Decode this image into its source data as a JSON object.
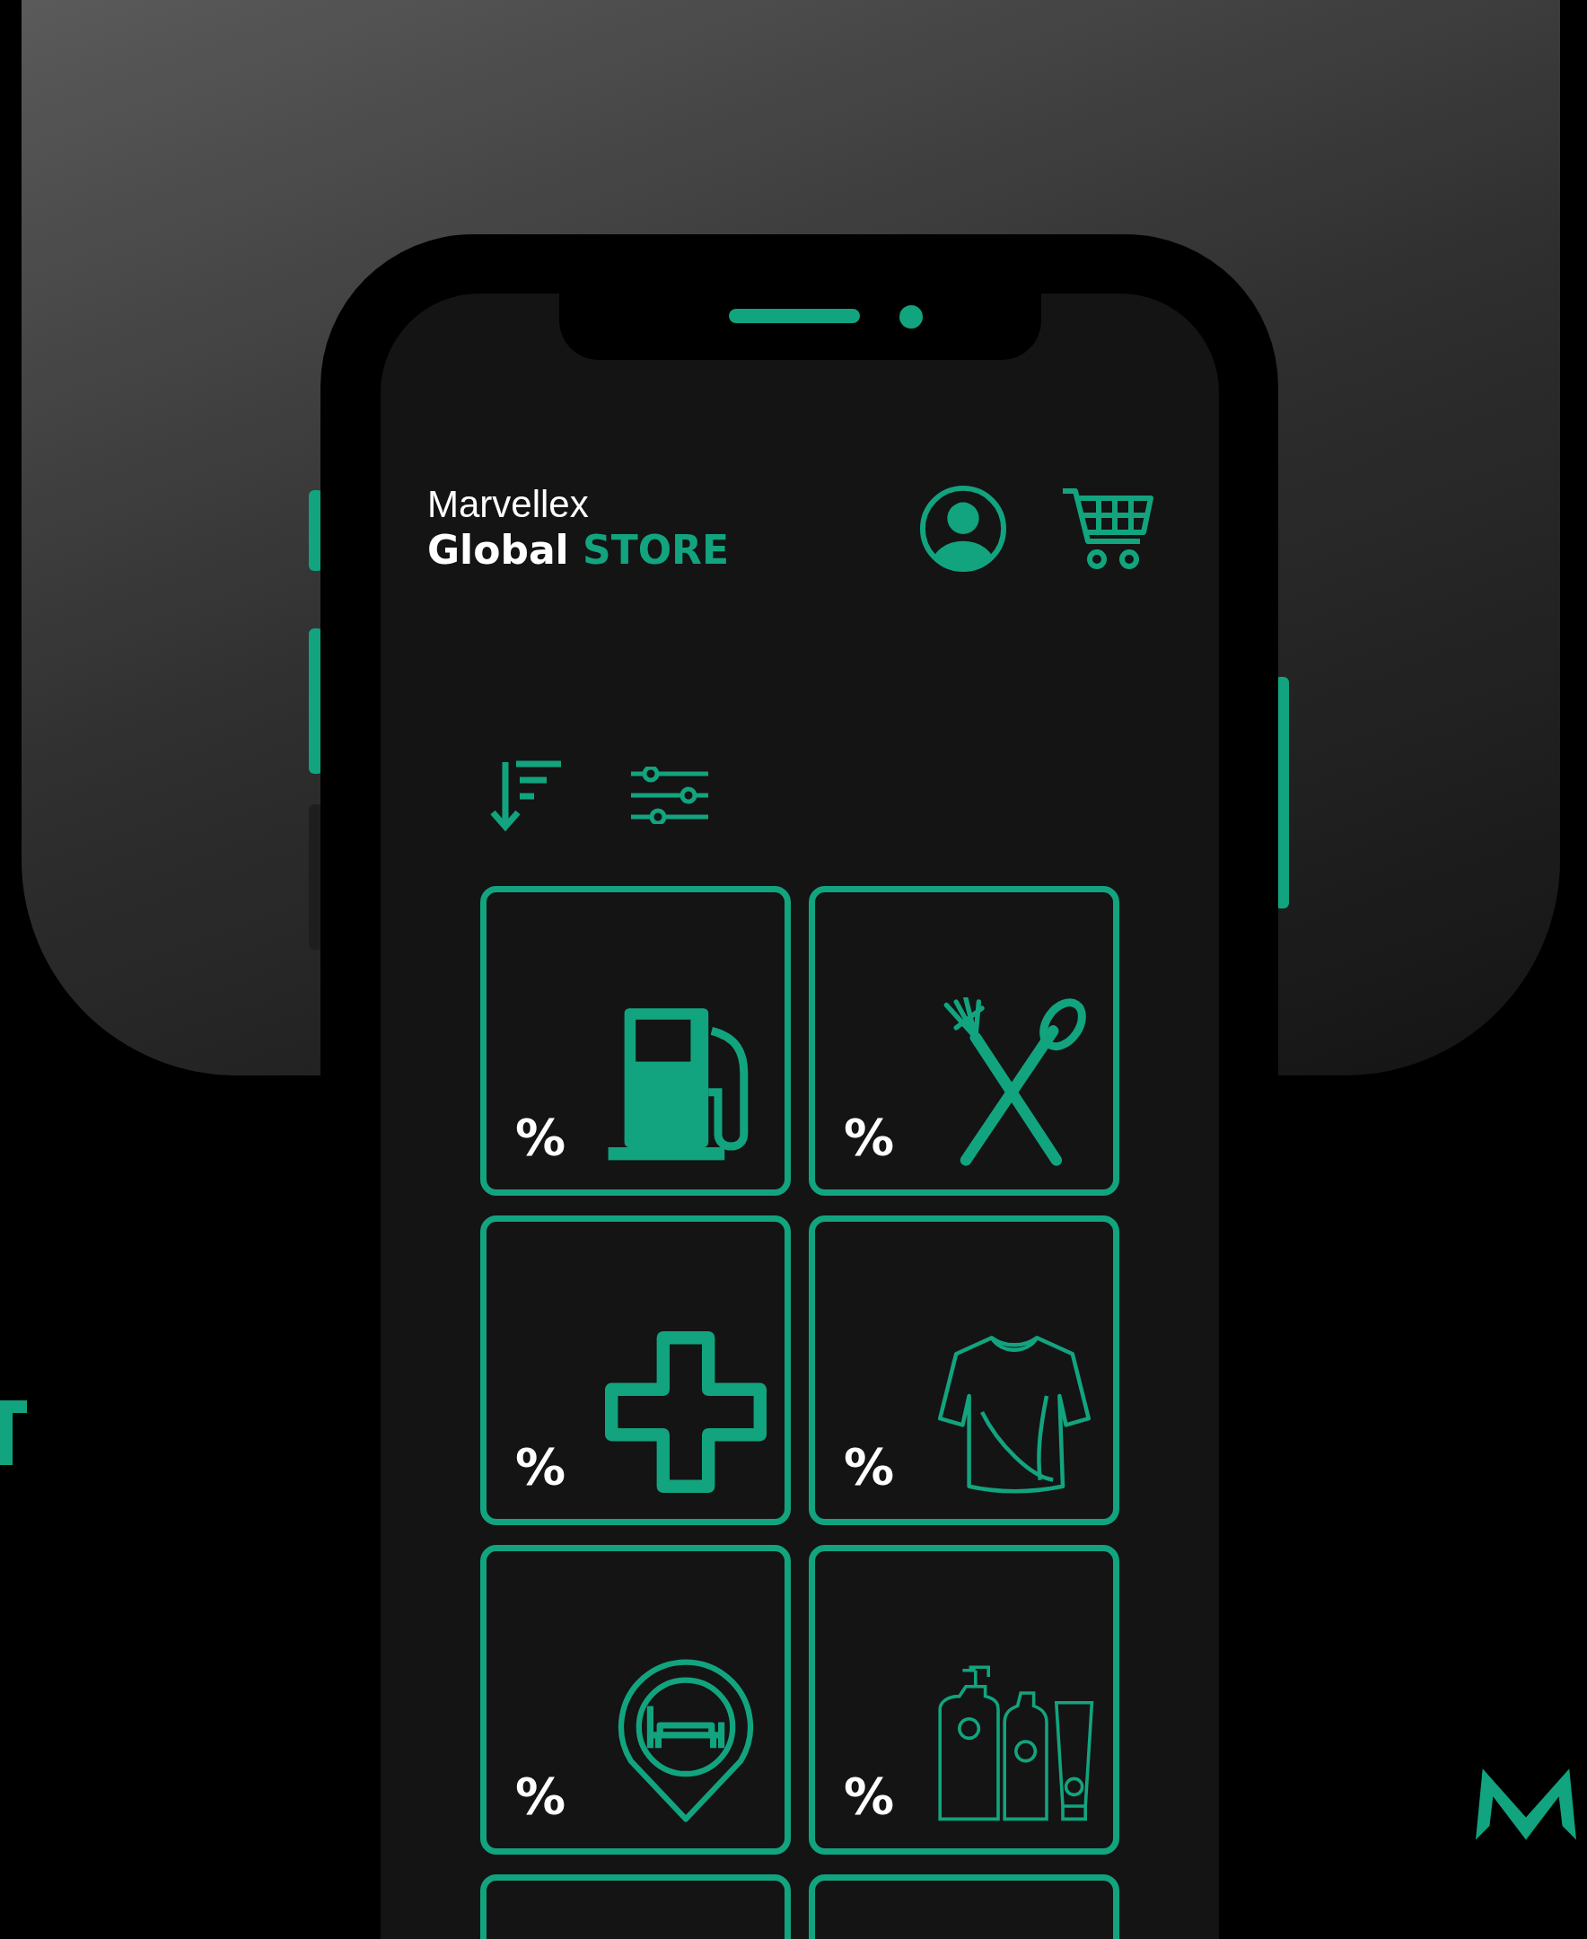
{
  "brand": {
    "line_1": "Marvellex",
    "line_2": "Global",
    "line_2_accent": "STORE"
  },
  "categories": [
    {
      "kind": "fuel",
      "label": "%"
    },
    {
      "kind": "food",
      "label": "%"
    },
    {
      "kind": "health",
      "label": "%"
    },
    {
      "kind": "clothing",
      "label": "%"
    },
    {
      "kind": "hotel",
      "label": "%"
    },
    {
      "kind": "cosmetics",
      "label": "%"
    },
    {
      "kind": "cut"
    },
    {
      "kind": "cut"
    }
  ]
}
